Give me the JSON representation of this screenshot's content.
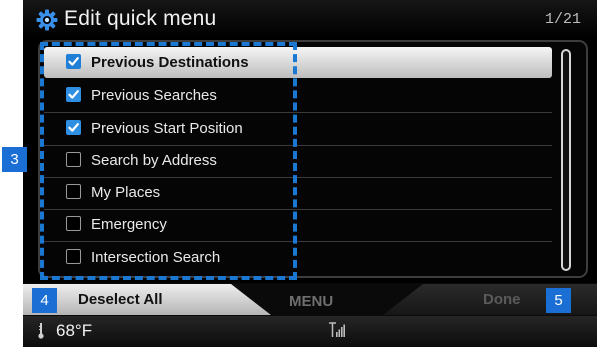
{
  "header": {
    "title": "Edit quick menu",
    "page_count": "1/21"
  },
  "menu": {
    "items": [
      {
        "label": "Previous Destinations",
        "checked": true,
        "highlighted": true
      },
      {
        "label": "Previous Searches",
        "checked": true,
        "highlighted": false
      },
      {
        "label": "Previous Start Position",
        "checked": true,
        "highlighted": false
      },
      {
        "label": "Search by Address",
        "checked": false,
        "highlighted": false
      },
      {
        "label": "My Places",
        "checked": false,
        "highlighted": false
      },
      {
        "label": "Emergency",
        "checked": false,
        "highlighted": false
      },
      {
        "label": "Intersection Search",
        "checked": false,
        "highlighted": false
      }
    ]
  },
  "bottom": {
    "deselect_label": "Deselect All",
    "menu_label": "MENU",
    "done_label": "Done"
  },
  "status": {
    "temperature": "68°F"
  },
  "callouts": {
    "list": "3",
    "deselect": "4",
    "done": "5"
  },
  "colors": {
    "accent": "#1b6fd4",
    "checkbox": "#2f8fe3",
    "highlight": "#e6e6e6"
  }
}
